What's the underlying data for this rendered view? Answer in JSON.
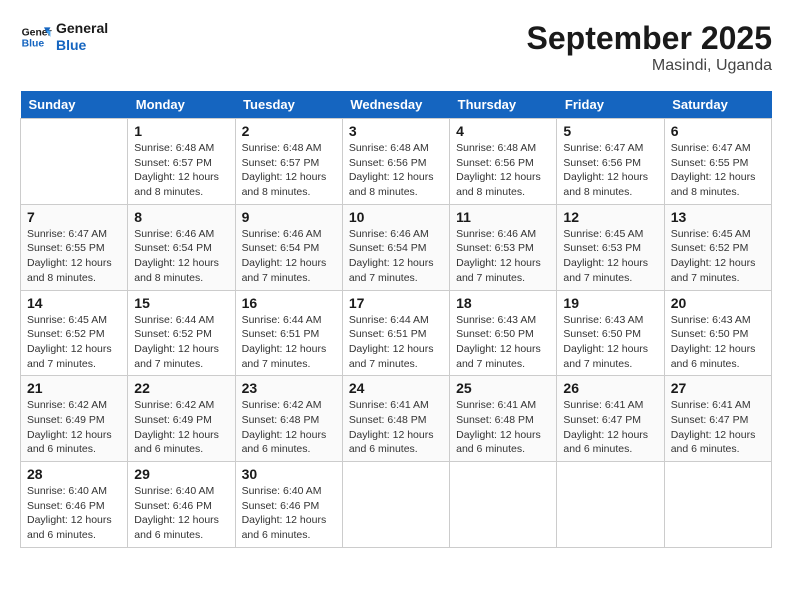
{
  "header": {
    "logo_general": "General",
    "logo_blue": "Blue",
    "month_title": "September 2025",
    "location": "Masindi, Uganda"
  },
  "days": [
    "Sunday",
    "Monday",
    "Tuesday",
    "Wednesday",
    "Thursday",
    "Friday",
    "Saturday"
  ],
  "weeks": [
    [
      {
        "date": "",
        "sunrise": "",
        "sunset": "",
        "daylight": ""
      },
      {
        "date": "1",
        "sunrise": "Sunrise: 6:48 AM",
        "sunset": "Sunset: 6:57 PM",
        "daylight": "Daylight: 12 hours and 8 minutes."
      },
      {
        "date": "2",
        "sunrise": "Sunrise: 6:48 AM",
        "sunset": "Sunset: 6:57 PM",
        "daylight": "Daylight: 12 hours and 8 minutes."
      },
      {
        "date": "3",
        "sunrise": "Sunrise: 6:48 AM",
        "sunset": "Sunset: 6:56 PM",
        "daylight": "Daylight: 12 hours and 8 minutes."
      },
      {
        "date": "4",
        "sunrise": "Sunrise: 6:48 AM",
        "sunset": "Sunset: 6:56 PM",
        "daylight": "Daylight: 12 hours and 8 minutes."
      },
      {
        "date": "5",
        "sunrise": "Sunrise: 6:47 AM",
        "sunset": "Sunset: 6:56 PM",
        "daylight": "Daylight: 12 hours and 8 minutes."
      },
      {
        "date": "6",
        "sunrise": "Sunrise: 6:47 AM",
        "sunset": "Sunset: 6:55 PM",
        "daylight": "Daylight: 12 hours and 8 minutes."
      }
    ],
    [
      {
        "date": "7",
        "sunrise": "Sunrise: 6:47 AM",
        "sunset": "Sunset: 6:55 PM",
        "daylight": "Daylight: 12 hours and 8 minutes."
      },
      {
        "date": "8",
        "sunrise": "Sunrise: 6:46 AM",
        "sunset": "Sunset: 6:54 PM",
        "daylight": "Daylight: 12 hours and 8 minutes."
      },
      {
        "date": "9",
        "sunrise": "Sunrise: 6:46 AM",
        "sunset": "Sunset: 6:54 PM",
        "daylight": "Daylight: 12 hours and 7 minutes."
      },
      {
        "date": "10",
        "sunrise": "Sunrise: 6:46 AM",
        "sunset": "Sunset: 6:54 PM",
        "daylight": "Daylight: 12 hours and 7 minutes."
      },
      {
        "date": "11",
        "sunrise": "Sunrise: 6:46 AM",
        "sunset": "Sunset: 6:53 PM",
        "daylight": "Daylight: 12 hours and 7 minutes."
      },
      {
        "date": "12",
        "sunrise": "Sunrise: 6:45 AM",
        "sunset": "Sunset: 6:53 PM",
        "daylight": "Daylight: 12 hours and 7 minutes."
      },
      {
        "date": "13",
        "sunrise": "Sunrise: 6:45 AM",
        "sunset": "Sunset: 6:52 PM",
        "daylight": "Daylight: 12 hours and 7 minutes."
      }
    ],
    [
      {
        "date": "14",
        "sunrise": "Sunrise: 6:45 AM",
        "sunset": "Sunset: 6:52 PM",
        "daylight": "Daylight: 12 hours and 7 minutes."
      },
      {
        "date": "15",
        "sunrise": "Sunrise: 6:44 AM",
        "sunset": "Sunset: 6:52 PM",
        "daylight": "Daylight: 12 hours and 7 minutes."
      },
      {
        "date": "16",
        "sunrise": "Sunrise: 6:44 AM",
        "sunset": "Sunset: 6:51 PM",
        "daylight": "Daylight: 12 hours and 7 minutes."
      },
      {
        "date": "17",
        "sunrise": "Sunrise: 6:44 AM",
        "sunset": "Sunset: 6:51 PM",
        "daylight": "Daylight: 12 hours and 7 minutes."
      },
      {
        "date": "18",
        "sunrise": "Sunrise: 6:43 AM",
        "sunset": "Sunset: 6:50 PM",
        "daylight": "Daylight: 12 hours and 7 minutes."
      },
      {
        "date": "19",
        "sunrise": "Sunrise: 6:43 AM",
        "sunset": "Sunset: 6:50 PM",
        "daylight": "Daylight: 12 hours and 7 minutes."
      },
      {
        "date": "20",
        "sunrise": "Sunrise: 6:43 AM",
        "sunset": "Sunset: 6:50 PM",
        "daylight": "Daylight: 12 hours and 6 minutes."
      }
    ],
    [
      {
        "date": "21",
        "sunrise": "Sunrise: 6:42 AM",
        "sunset": "Sunset: 6:49 PM",
        "daylight": "Daylight: 12 hours and 6 minutes."
      },
      {
        "date": "22",
        "sunrise": "Sunrise: 6:42 AM",
        "sunset": "Sunset: 6:49 PM",
        "daylight": "Daylight: 12 hours and 6 minutes."
      },
      {
        "date": "23",
        "sunrise": "Sunrise: 6:42 AM",
        "sunset": "Sunset: 6:48 PM",
        "daylight": "Daylight: 12 hours and 6 minutes."
      },
      {
        "date": "24",
        "sunrise": "Sunrise: 6:41 AM",
        "sunset": "Sunset: 6:48 PM",
        "daylight": "Daylight: 12 hours and 6 minutes."
      },
      {
        "date": "25",
        "sunrise": "Sunrise: 6:41 AM",
        "sunset": "Sunset: 6:48 PM",
        "daylight": "Daylight: 12 hours and 6 minutes."
      },
      {
        "date": "26",
        "sunrise": "Sunrise: 6:41 AM",
        "sunset": "Sunset: 6:47 PM",
        "daylight": "Daylight: 12 hours and 6 minutes."
      },
      {
        "date": "27",
        "sunrise": "Sunrise: 6:41 AM",
        "sunset": "Sunset: 6:47 PM",
        "daylight": "Daylight: 12 hours and 6 minutes."
      }
    ],
    [
      {
        "date": "28",
        "sunrise": "Sunrise: 6:40 AM",
        "sunset": "Sunset: 6:46 PM",
        "daylight": "Daylight: 12 hours and 6 minutes."
      },
      {
        "date": "29",
        "sunrise": "Sunrise: 6:40 AM",
        "sunset": "Sunset: 6:46 PM",
        "daylight": "Daylight: 12 hours and 6 minutes."
      },
      {
        "date": "30",
        "sunrise": "Sunrise: 6:40 AM",
        "sunset": "Sunset: 6:46 PM",
        "daylight": "Daylight: 12 hours and 6 minutes."
      },
      {
        "date": "",
        "sunrise": "",
        "sunset": "",
        "daylight": ""
      },
      {
        "date": "",
        "sunrise": "",
        "sunset": "",
        "daylight": ""
      },
      {
        "date": "",
        "sunrise": "",
        "sunset": "",
        "daylight": ""
      },
      {
        "date": "",
        "sunrise": "",
        "sunset": "",
        "daylight": ""
      }
    ]
  ]
}
